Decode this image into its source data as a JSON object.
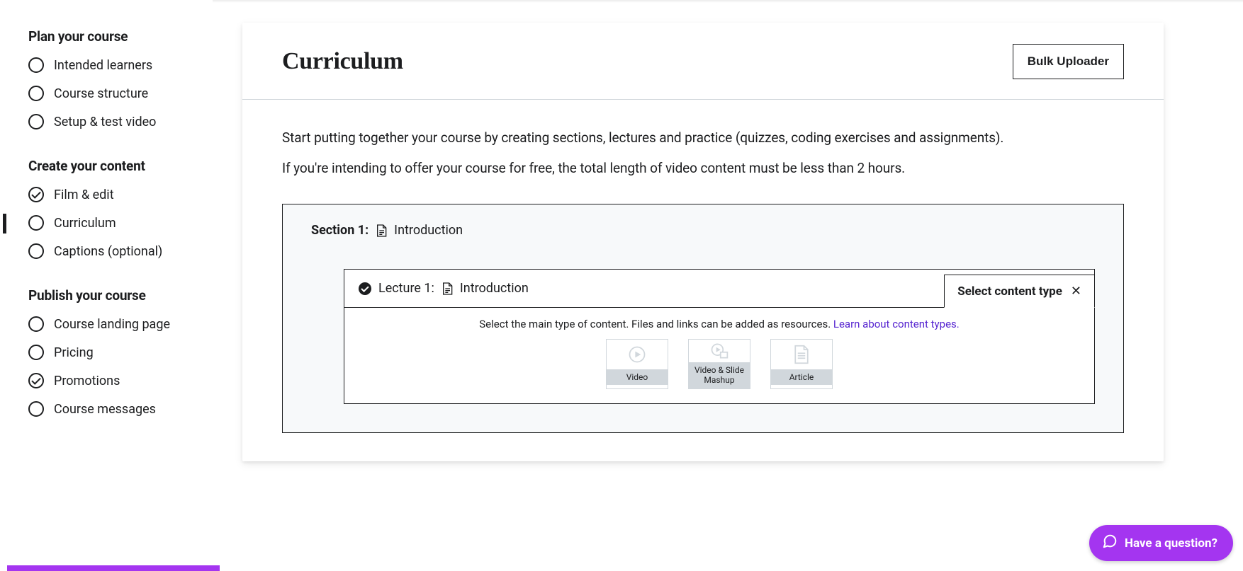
{
  "sidebar": {
    "groups": [
      {
        "title": "Plan your course",
        "items": [
          {
            "label": "Intended learners",
            "checked": false,
            "active": false
          },
          {
            "label": "Course structure",
            "checked": false,
            "active": false
          },
          {
            "label": "Setup & test video",
            "checked": false,
            "active": false
          }
        ]
      },
      {
        "title": "Create your content",
        "items": [
          {
            "label": "Film & edit",
            "checked": true,
            "active": false
          },
          {
            "label": "Curriculum",
            "checked": false,
            "active": true
          },
          {
            "label": "Captions (optional)",
            "checked": false,
            "active": false
          }
        ]
      },
      {
        "title": "Publish your course",
        "items": [
          {
            "label": "Course landing page",
            "checked": false,
            "active": false
          },
          {
            "label": "Pricing",
            "checked": false,
            "active": false
          },
          {
            "label": "Promotions",
            "checked": true,
            "active": false
          },
          {
            "label": "Course messages",
            "checked": false,
            "active": false
          }
        ]
      }
    ]
  },
  "header": {
    "title": "Curriculum",
    "bulk_uploader": "Bulk Uploader"
  },
  "intro": {
    "line1": "Start putting together your course by creating sections, lectures and practice (quizzes, coding exercises and assignments).",
    "line2": "If you're intending to offer your course for free, the total length of video content must be less than 2 hours."
  },
  "section": {
    "label": "Section 1:",
    "title": "Introduction"
  },
  "lecture": {
    "label": "Lecture 1:",
    "title": "Introduction",
    "tab_label": "Select content type",
    "hint_text": "Select the main type of content. Files and links can be added as resources. ",
    "hint_link": "Learn about content types.",
    "types": [
      {
        "label": "Video",
        "icon": "play"
      },
      {
        "label": "Video & Slide Mashup",
        "icon": "mashup"
      },
      {
        "label": "Article",
        "icon": "article"
      }
    ]
  },
  "help": {
    "label": "Have a question?"
  },
  "colors": {
    "accent": "#a435f0",
    "link": "#5624d0",
    "bg_soft": "#f7f9fa",
    "border_light": "#d1d7dc"
  }
}
